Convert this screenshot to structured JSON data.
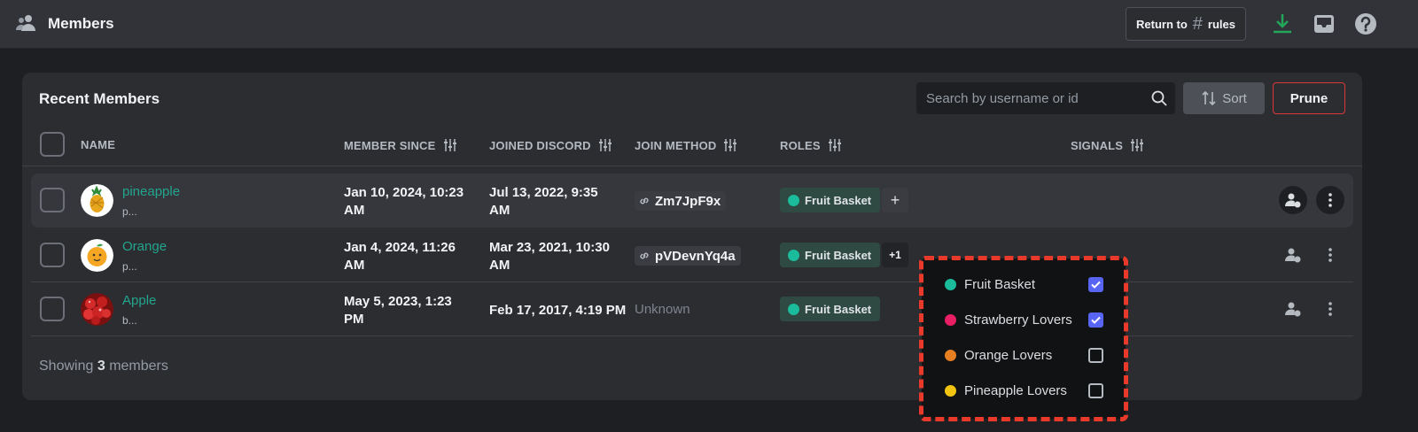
{
  "topbar": {
    "title": "Members",
    "return_label": "Return to",
    "return_hash": "#",
    "return_channel": "rules",
    "icons": [
      "members-icon",
      "download-icon",
      "inbox-icon",
      "help-icon"
    ],
    "colors": {
      "download": "#23a55a"
    }
  },
  "card": {
    "title": "Recent Members",
    "search_placeholder": "Search by username or id",
    "sort_label": "Sort",
    "prune_label": "Prune",
    "columns": {
      "name": "NAME",
      "member_since": "MEMBER SINCE",
      "joined_discord": "JOINED DISCORD",
      "join_method": "JOIN METHOD",
      "roles": "ROLES",
      "signals": "SIGNALS"
    },
    "members": [
      {
        "name": "pineapple",
        "sub": "p...",
        "member_since_1": "Jan 10, 2024, 10:23",
        "member_since_2": "AM",
        "joined_discord_1": "Jul 13, 2022, 9:35",
        "joined_discord_2": "AM",
        "join_method": "Zm7JpF9x",
        "role": "Fruit Basket",
        "role_extra": "+"
      },
      {
        "name": "Orange",
        "sub": "p...",
        "member_since_1": "Jan 4, 2024, 11:26",
        "member_since_2": "AM",
        "joined_discord_1": "Mar 23, 2021, 10:30",
        "joined_discord_2": "AM",
        "join_method": "pVDevnYq4a",
        "role": "Fruit Basket",
        "role_extra": "+1"
      },
      {
        "name": "Apple",
        "sub": "b...",
        "member_since_1": "May 5, 2023, 1:23",
        "member_since_2": "PM",
        "joined_discord": "Feb 17, 2017, 4:19 PM",
        "join_method": "Unknown",
        "role": "Fruit Basket"
      }
    ],
    "footer_prefix": "Showing",
    "footer_count": "3",
    "footer_suffix": "members"
  },
  "role_dropdown": {
    "options": [
      {
        "label": "Fruit Basket",
        "color": "#1abc9c",
        "checked": true
      },
      {
        "label": "Strawberry Lovers",
        "color": "#e91e63",
        "checked": true
      },
      {
        "label": "Orange Lovers",
        "color": "#e67e22",
        "checked": false
      },
      {
        "label": "Pineapple Lovers",
        "color": "#f1c40f",
        "checked": false
      }
    ]
  }
}
